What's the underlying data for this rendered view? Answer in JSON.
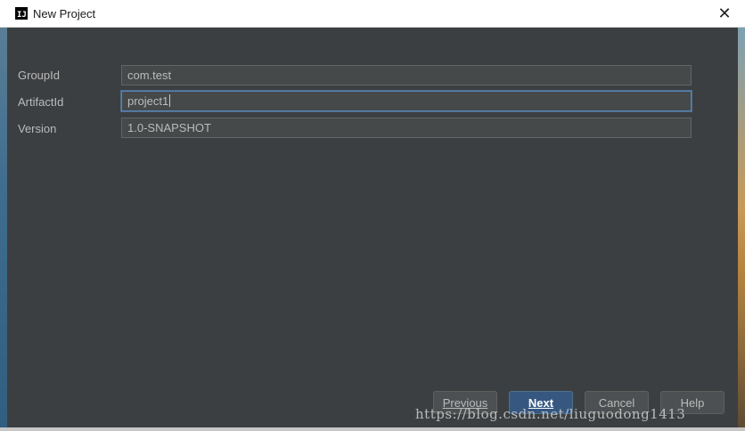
{
  "window": {
    "title": "New Project",
    "icon_label": "IJ",
    "close_glyph": "✕"
  },
  "form": {
    "fields": [
      {
        "label": "GroupId",
        "value": "com.test"
      },
      {
        "label": "ArtifactId",
        "value": "project1"
      },
      {
        "label": "Version",
        "value": "1.0-SNAPSHOT"
      }
    ]
  },
  "buttons": {
    "previous": "Previous",
    "next": "Next",
    "cancel": "Cancel",
    "help": "Help"
  },
  "watermark": "https://blog.csdn.net/liuguodong1413",
  "colors": {
    "dialog_bg": "#3c3f41",
    "field_bg": "#45494a",
    "focus_border": "#5a86b3",
    "primary_button": "#365880"
  }
}
